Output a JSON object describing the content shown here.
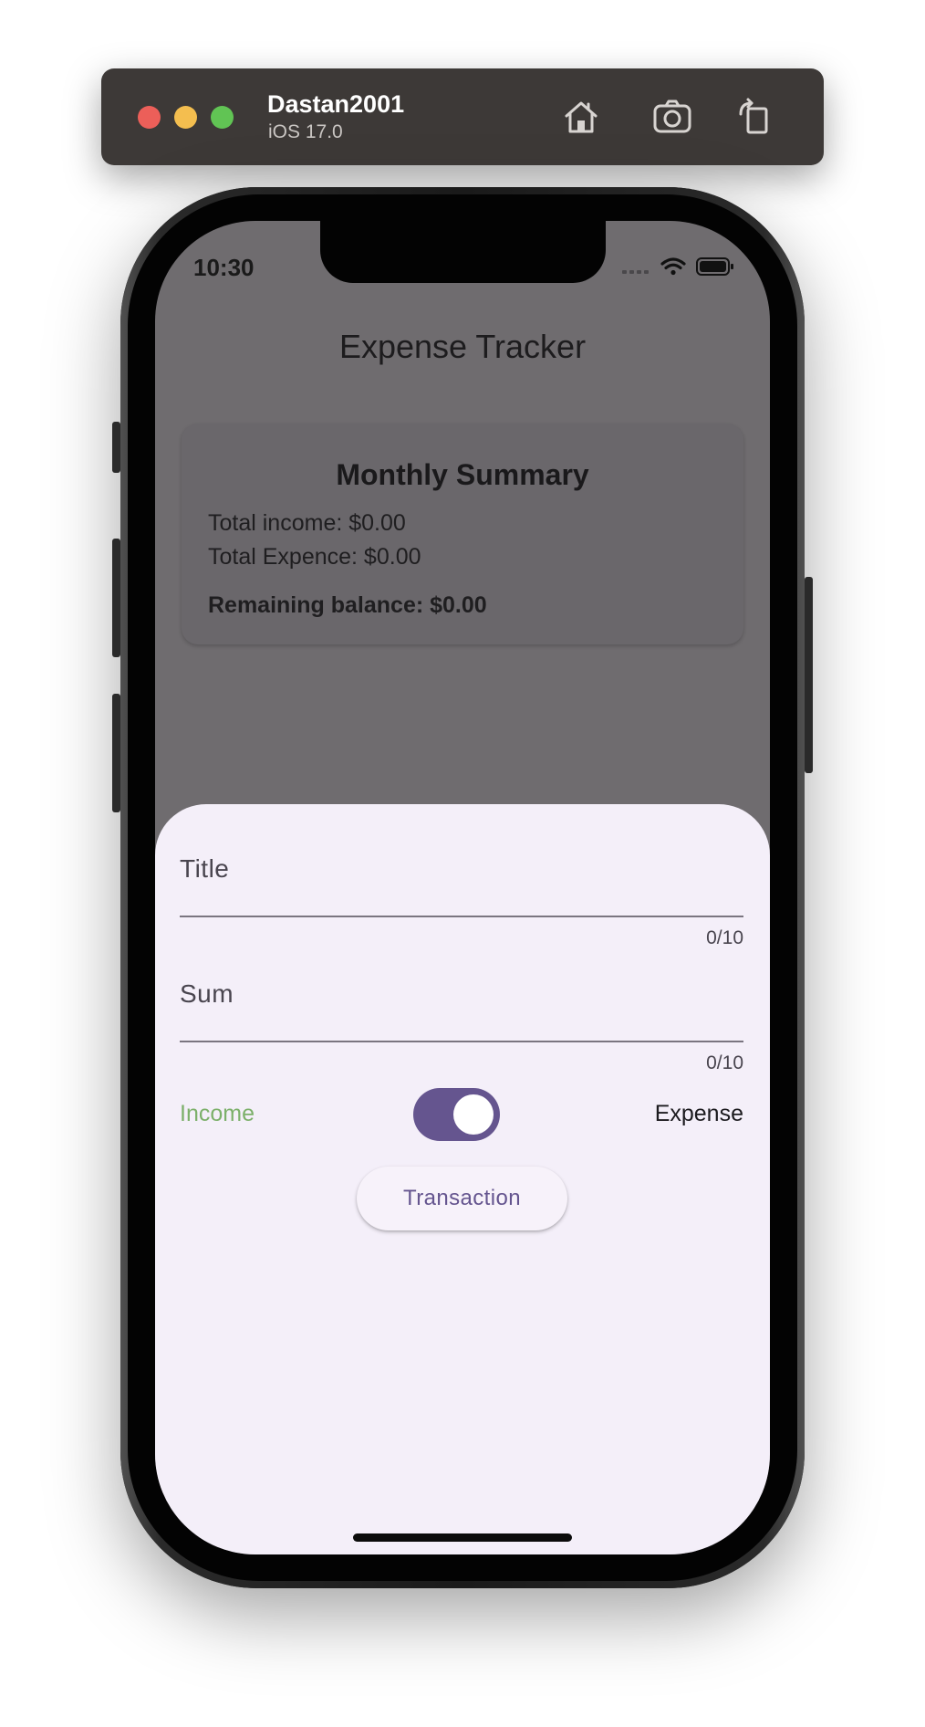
{
  "simulator": {
    "device_name": "Dastan2001",
    "os_version": "iOS 17.0",
    "icons": [
      "home-icon",
      "screenshot-icon",
      "rotate-icon"
    ]
  },
  "status_bar": {
    "time": "10:30",
    "icons": [
      "signal-icon",
      "wifi-icon",
      "battery-icon"
    ]
  },
  "app_bar": {
    "title": "Expense Tracker"
  },
  "summary": {
    "title": "Monthly Summary",
    "income_label": "Total income:  $0.00",
    "expense_label": "Total Expence:  $0.00",
    "balance_label": "Remaining balance: $0.00"
  },
  "form": {
    "title_field": {
      "label": "Title",
      "value": "",
      "counter": "0/10"
    },
    "sum_field": {
      "label": "Sum",
      "value": "",
      "counter": "0/10"
    },
    "toggle": {
      "left_label": "Income",
      "right_label": "Expense",
      "on": true
    },
    "submit_label": "Transaction"
  },
  "colors": {
    "primary": "#65558f",
    "income_green": "#7cb06a",
    "sheet_background": "#f4eff9",
    "scrim": "#6f6c6f",
    "simulator_bar": "#3d3937"
  }
}
